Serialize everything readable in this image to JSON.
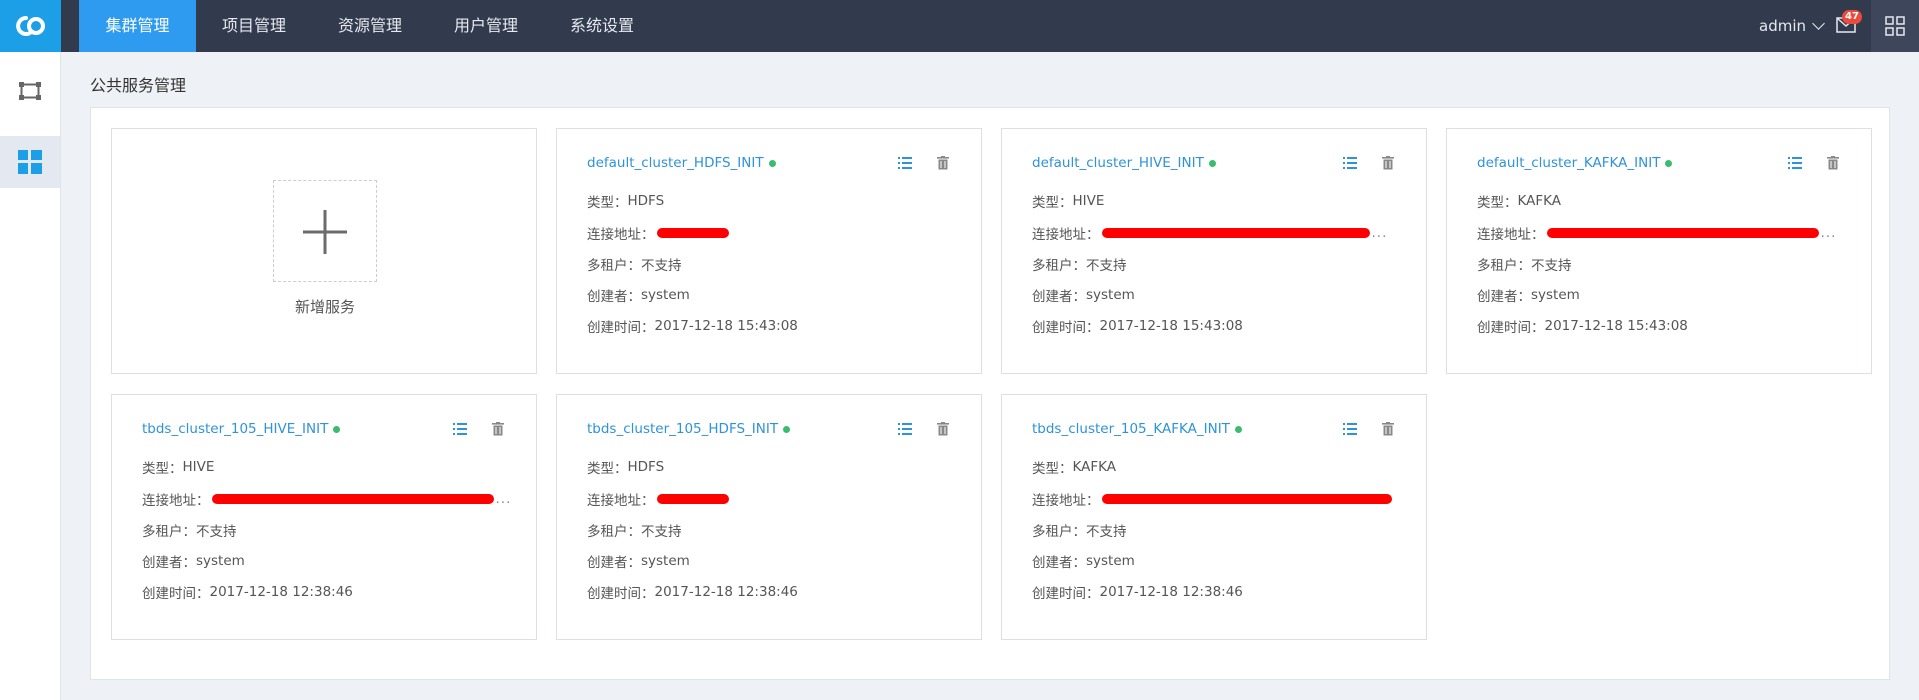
{
  "topbar": {
    "nav": [
      "集群管理",
      "项目管理",
      "资源管理",
      "用户管理",
      "系统设置"
    ],
    "active_nav": "集群管理",
    "user": "admin",
    "unread": "47",
    "accent": "#2e9bf0"
  },
  "sidebar": {
    "items": [
      "cluster-topology-icon",
      "services-grid-icon"
    ],
    "active": "services-grid-icon"
  },
  "page": {
    "title": "公共服务管理"
  },
  "add_service": {
    "label": "新增服务"
  },
  "labels": {
    "type": "类型：",
    "address": "连接地址：",
    "multi_tenant": "多租户：",
    "creator": "创建者：",
    "created_at": "创建时间："
  },
  "services": [
    {
      "name": "default_cluster_HDFS_INIT",
      "type": "HDFS",
      "multi_tenant": "不支持",
      "creator": "system",
      "created_at": "2017-12-18 15:43:08",
      "status": "running"
    },
    {
      "name": "default_cluster_HIVE_INIT",
      "type": "HIVE",
      "multi_tenant": "不支持",
      "creator": "system",
      "created_at": "2017-12-18 15:43:08",
      "status": "running"
    },
    {
      "name": "default_cluster_KAFKA_INIT",
      "type": "KAFKA",
      "multi_tenant": "不支持",
      "creator": "system",
      "created_at": "2017-12-18 15:43:08",
      "status": "running"
    },
    {
      "name": "tbds_cluster_105_HIVE_INIT",
      "type": "HIVE",
      "multi_tenant": "不支持",
      "creator": "system",
      "created_at": "2017-12-18 12:38:46",
      "status": "running"
    },
    {
      "name": "tbds_cluster_105_HDFS_INIT",
      "type": "HDFS",
      "multi_tenant": "不支持",
      "creator": "system",
      "created_at": "2017-12-18 12:38:46",
      "status": "running"
    },
    {
      "name": "tbds_cluster_105_KAFKA_INIT",
      "type": "KAFKA",
      "multi_tenant": "不支持",
      "creator": "system",
      "created_at": "2017-12-18 12:38:46",
      "status": "running"
    }
  ],
  "colors": {
    "status_running": "#3bbb70",
    "link": "#2e93d9",
    "redaction": "#ff0000"
  },
  "ellipsis": "..."
}
